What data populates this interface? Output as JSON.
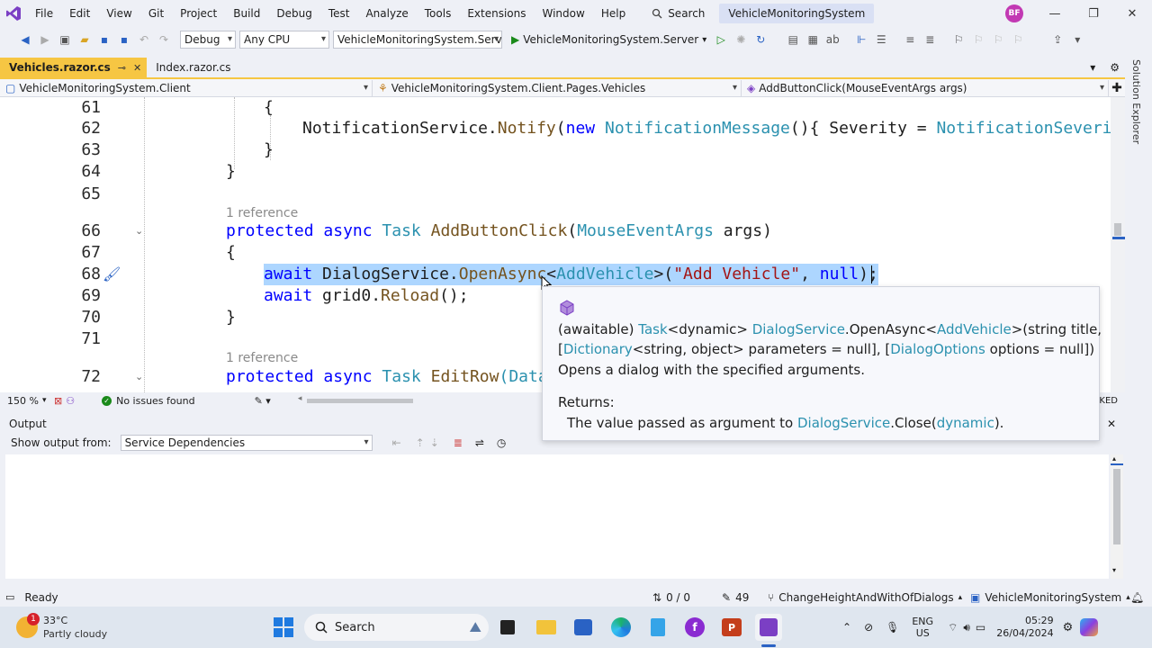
{
  "menu": {
    "items": [
      "File",
      "Edit",
      "View",
      "Git",
      "Project",
      "Build",
      "Debug",
      "Test",
      "Analyze",
      "Tools",
      "Extensions",
      "Window",
      "Help"
    ],
    "search_label": "Search",
    "solution_name": "VehicleMonitoringSystem",
    "avatar_initials": "BF"
  },
  "toolbar": {
    "config": "Debug",
    "platform": "Any CPU",
    "startup_project": "VehicleMonitoringSystem.Server",
    "run_label": "VehicleMonitoringSystem.Server"
  },
  "tabs": [
    {
      "label": "Vehicles.razor.cs",
      "active": true
    },
    {
      "label": "Index.razor.cs",
      "active": false
    }
  ],
  "navbar": {
    "project": "VehicleMonitoringSystem.Client",
    "class": "VehicleMonitoringSystem.Client.Pages.Vehicles",
    "member": "AddButtonClick(MouseEventArgs args)"
  },
  "code": {
    "line_numbers": [
      "61",
      "62",
      "63",
      "64",
      "65",
      "66",
      "67",
      "68",
      "69",
      "70",
      "71",
      "72"
    ],
    "ref_hint": "1 reference",
    "l61": "{",
    "l62_a": "NotificationService.",
    "l62_b": "Notify",
    "l62_c": "(",
    "l62_d": "new",
    "l62_e": " ",
    "l62_f": "NotificationMessage",
    "l62_g": "(){ Severity = ",
    "l62_h": "NotificationSeverit",
    "l63": "}",
    "l64": "}",
    "l66_a": "protected",
    "l66_b": "async",
    "l66_c": "Task",
    "l66_d": "AddButtonClick",
    "l66_e": "(",
    "l66_f": "MouseEventArgs",
    "l66_g": " args)",
    "l67": "{",
    "l68_a": "await",
    "l68_b": " DialogService.",
    "l68_c": "OpenAsync",
    "l68_d": "<",
    "l68_e": "AddVehicle",
    "l68_f": ">(",
    "l68_g": "\"Add Vehicle\"",
    "l68_h": ", ",
    "l68_i": "null",
    "l68_j": ");",
    "l69_a": "await",
    "l69_b": " grid0.",
    "l69_c": "Reload",
    "l69_d": "();",
    "l70": "}",
    "l72_a": "protected",
    "l72_b": "async",
    "l72_c": "Task",
    "l72_d": "EditRow",
    "l72_e": "(Data"
  },
  "tooltip": {
    "l1_a": "(awaitable) ",
    "l1_b": "Task",
    "l1_c": "<dynamic> ",
    "l1_d": "DialogService",
    "l1_e": ".OpenAsync<",
    "l1_f": "AddVehicle",
    "l1_g": ">(string title,",
    "l2_a": "[",
    "l2_b": "Dictionary",
    "l2_c": "<string, object> parameters = null], [",
    "l2_d": "DialogOptions",
    "l2_e": " options = null])",
    "l3": "Opens a dialog with the specified arguments.",
    "returns_label": "Returns:",
    "ret_a": "The value passed as argument to ",
    "ret_b": "DialogService",
    "ret_c": ".Close(",
    "ret_d": "dynamic",
    "ret_e": ")."
  },
  "editor_status": {
    "zoom": "150 %",
    "issues": "No issues found",
    "right_fragment": "KED"
  },
  "output": {
    "title": "Output",
    "show_from_label": "Show output from:",
    "source": "Service Dependencies"
  },
  "statusbar": {
    "ready": "Ready",
    "changes": "0 / 0",
    "edits": "49",
    "branch": "ChangeHeightAndWithOfDialogs",
    "repo": "VehicleMonitoringSystem"
  },
  "side_panel": "Solution Explorer",
  "taskbar": {
    "temperature": "33°C",
    "weather": "Partly cloudy",
    "weather_badge": "1",
    "search": "Search",
    "lang1": "ENG",
    "lang2": "US",
    "time": "05:29",
    "date": "26/04/2024"
  },
  "colors": {
    "keyword": "#0000ff",
    "type": "#2b91af",
    "method": "#74531f",
    "string": "#a31515",
    "selection": "#add6ff",
    "active_tab": "#f6c643"
  }
}
